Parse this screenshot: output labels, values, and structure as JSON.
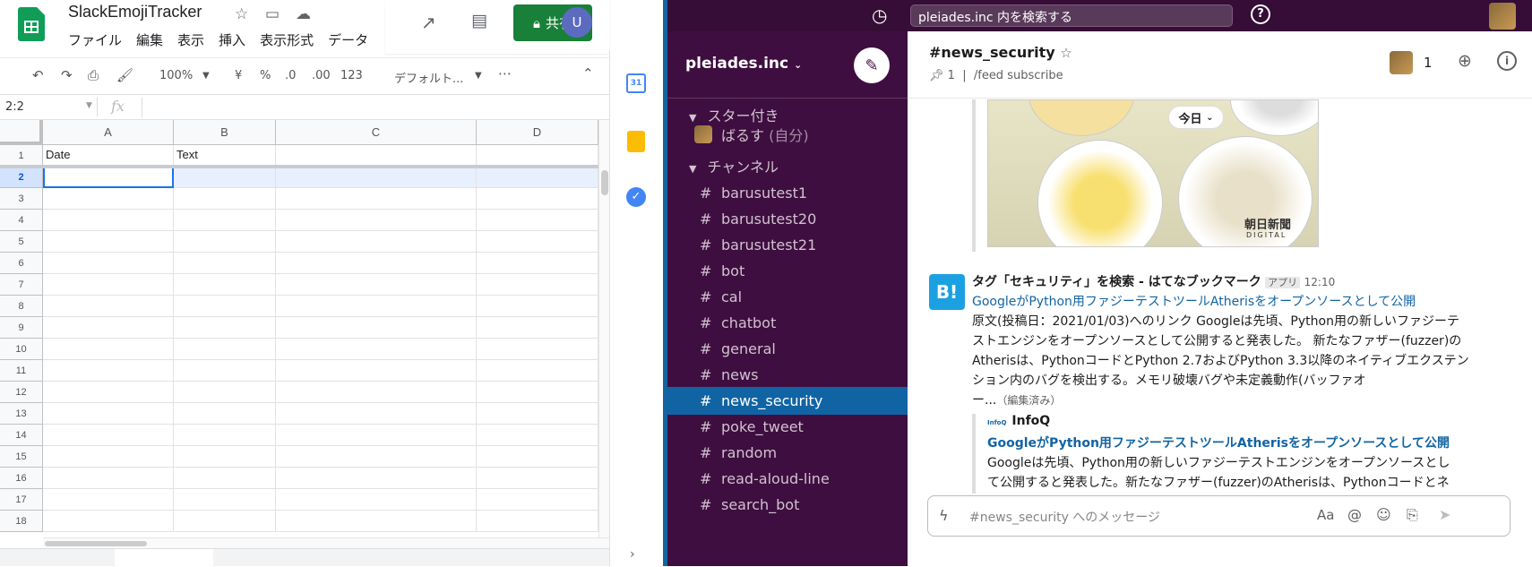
{
  "sheets": {
    "doc_title": "SlackEmojiTracker",
    "menus": [
      "ファイル",
      "編集",
      "表示",
      "挿入",
      "表示形式",
      "データ"
    ],
    "share_label": "共有",
    "avatar_letter": "U",
    "toolbar": {
      "zoom": "100%",
      "currency": "¥",
      "percent": "%",
      "dec_less": ".0",
      "dec_more": ".00",
      "format": "123",
      "font": "デフォルト..."
    },
    "name_box": "2:2",
    "fx": "fx",
    "columns": [
      "A",
      "B",
      "C",
      "D"
    ],
    "rows": [
      "1",
      "2",
      "3",
      "4",
      "5",
      "6",
      "7",
      "8",
      "9",
      "10",
      "11",
      "12",
      "13",
      "14",
      "15",
      "16",
      "17",
      "18"
    ],
    "cells": {
      "A1": "Date",
      "B1": "Text"
    }
  },
  "slack": {
    "search_placeholder": "pleiades.inc 内を検索する",
    "workspace": "pleiades.inc",
    "starred_label": "スター付き",
    "self_name": "ばるす",
    "self_suffix": "(自分)",
    "channels_label": "チャンネル",
    "channels": [
      "barusutest1",
      "barusutest20",
      "barusutest21",
      "bot",
      "cal",
      "chatbot",
      "general",
      "news",
      "news_security",
      "poke_tweet",
      "random",
      "read-aloud-line",
      "search_bot"
    ],
    "active_channel": "news_security",
    "header": {
      "name": "#news_security",
      "pins": "1",
      "topic": "/feed subscribe",
      "member_count": "1"
    },
    "today_label": "今日",
    "image_caption": "朝日新聞",
    "image_caption_sub": "DIGITAL",
    "message": {
      "author": "タグ「セキュリティ」を検索 - はてなブックマーク",
      "badge": "アプリ",
      "time": "12:10",
      "link": "GoogleがPython用ファジーテストツールAtherisをオープンソースとして公開",
      "text": [
        "原文(投稿日：2021/01/03)へのリンク Googleは先頃、Python用の新しいファジーテ",
        "ストエンジンをオープンソースとして公開すると発表した。 新たなファザー(fuzzer)の",
        "Atherisは、PythonコードとPython 2.7およびPython 3.3以降のネイティブエクステン",
        "ション内のバグを検出する。メモリ破壊バグや未定義動作(バッファオ"
      ],
      "text_end": "ー...",
      "edited": "（編集済み）",
      "attachment": {
        "source": "InfoQ",
        "title": "GoogleがPython用ファジーテストツールAtherisをオープンソースとして公開",
        "text": [
          "Googleは先頃、Python用の新しいファジーテストエンジンをオープンソースとし",
          "て公開すると発表した。新たなファザー(fuzzer)のAtherisは、Pythonコードとネ"
        ]
      }
    },
    "composer_placeholder": "#news_security へのメッセージ",
    "composer_aa": "Aa"
  }
}
